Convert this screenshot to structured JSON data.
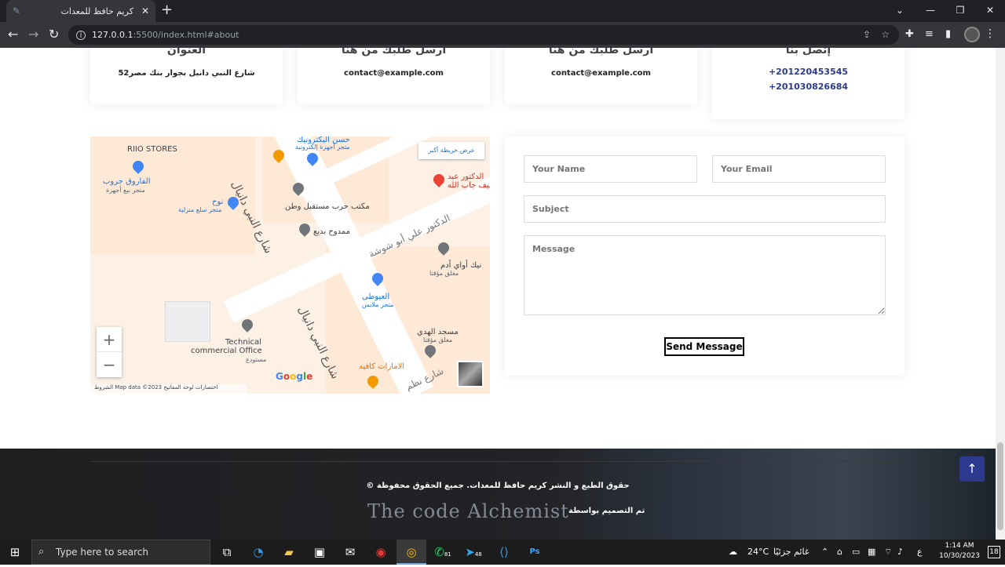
{
  "browser": {
    "tab_title": "كريم حافظ للمعدات",
    "url_host": "127.0.0.1",
    "url_path": ":5500/index.html#about"
  },
  "contact_info": [
    {
      "title": "العنوان",
      "lines": [
        "شارع النبي دانيل بجوار بنك مصر52"
      ],
      "blue": false
    },
    {
      "title": "ارسل طلبك من هنا",
      "lines": [
        "contact@example.com"
      ],
      "blue": false
    },
    {
      "title": "ارسل طلبك من هنا",
      "lines": [
        "contact@example.com"
      ],
      "blue": false
    },
    {
      "title": "إتصل بنا",
      "lines": [
        "+201220453545",
        "+201030826684"
      ],
      "blue": true
    }
  ],
  "map": {
    "bigger_map_link": "عرض خريطة أكبر",
    "labels": {
      "riio": "RIIO STORES",
      "farouk": "الفاروق جروب",
      "farouk_sub": "متجر بيع أجهزة",
      "nouh": "نوح",
      "nouh_sub": "متجر سلع منزلية",
      "hassan": "حسن اليكترونيك",
      "hassan_sub": "متجر أجهزة إلكترونية",
      "doctor_abd": "الدكتور عبد",
      "doctor_abd_sub": "لطيف جاب الله",
      "harb": "مكتب حرب مستقبل وطن",
      "mamdouh": "ممدوح بديع",
      "abushousha": "الدكتور علي أبو شوشة",
      "nik": "نيك أواي أدم",
      "nik_sub": "مغلق مؤقتا",
      "ewaty": "العيوطى",
      "ewaty_sub": "متجر ملابس",
      "mosque": "مسجد الهدي",
      "mosque_sub": "مغلق مؤقتا",
      "technical": "Technical",
      "technical2": "commercial Office",
      "technical_sub": "مستودع",
      "emirates": "الامارات كافيه",
      "street1": "شارع النبي دانيال",
      "street2": "شارع النبي دانيال",
      "street3": "شارع نظم"
    },
    "zoom_in": "+",
    "zoom_out": "−",
    "google": "Google",
    "footer_text": "الشروط   Map data ©2023   اختصارات لوحة المفاتيح"
  },
  "form": {
    "name_placeholder": "Your Name",
    "email_placeholder": "Your Email",
    "subject_placeholder": "Subject",
    "message_placeholder": "Message",
    "send_label": "Send Message"
  },
  "footer": {
    "copyright": "© حقوق الطبع و النشر كريم حافظ للمعدات. جميع الحقوق محفوظة",
    "designed_by": "تم التصميم بواسطة",
    "logo_text": "The code Alchemist"
  },
  "taskbar": {
    "search_placeholder": "Type here to search",
    "weather_temp": "24°C",
    "weather_text": "غائم جزئيًا",
    "time": "1:14 AM",
    "date": "10/30/2023",
    "notif_count": "18",
    "whatsapp_badge": "81",
    "telegram_badge": "48",
    "lang": "ع"
  }
}
